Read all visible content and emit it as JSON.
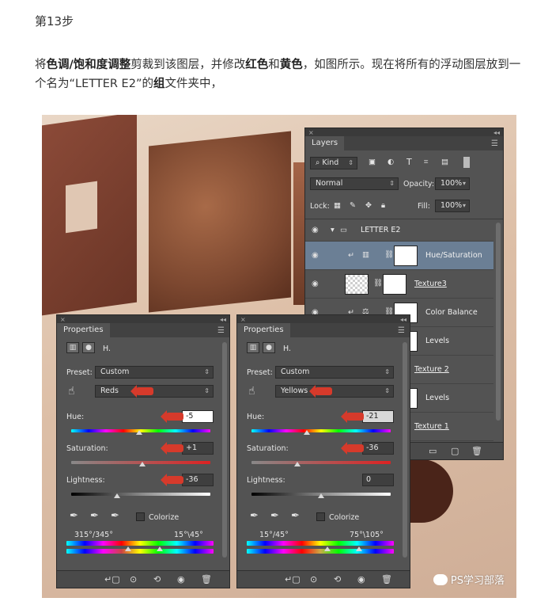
{
  "article": {
    "step_title": "第13步",
    "p1_a": "将",
    "p1_b": "色调/饱和度调整",
    "p1_c": "剪裁到该图层，并修改",
    "p1_d": "红色",
    "p1_e": "和",
    "p1_f": "黄色",
    "p1_g": "，如图所示。现在将所有的浮动图层放到一个名为“LETTER E2”的",
    "p1_h": "组",
    "p1_i": "文件夹中，"
  },
  "layers_panel": {
    "tab": "Layers",
    "kind": "Kind",
    "blend_mode": "Normal",
    "opacity_label": "Opacity:",
    "opacity_value": "100%",
    "lock_label": "Lock:",
    "fill_label": "Fill:",
    "fill_value": "100%",
    "group_name": "LETTER E2",
    "layers": [
      {
        "name": "Hue/Saturation"
      },
      {
        "name": "Texture3"
      },
      {
        "name": "Color Balance"
      },
      {
        "name": "Levels"
      },
      {
        "name": "Texture 2"
      },
      {
        "name": "Levels"
      },
      {
        "name": "Texture 1"
      }
    ]
  },
  "props_left": {
    "tab": "Properties",
    "header": "H.",
    "preset_label": "Preset:",
    "preset_value": "Custom",
    "channel_value": "Reds",
    "hue_label": "Hue:",
    "hue_value": "-5",
    "saturation_label": "Saturation:",
    "saturation_value": "+1",
    "lightness_label": "Lightness:",
    "lightness_value": "-36",
    "colorize_label": "Colorize",
    "range_left": "315°/345°",
    "range_right": "15°\\45°"
  },
  "props_right": {
    "tab": "Properties",
    "header": "H.",
    "preset_label": "Preset:",
    "preset_value": "Custom",
    "channel_value": "Yellows",
    "hue_label": "Hue:",
    "hue_value": "-21",
    "saturation_label": "Saturation:",
    "saturation_value": "-36",
    "lightness_label": "Lightness:",
    "lightness_value": "0",
    "colorize_label": "Colorize",
    "range_left": "15°/45°",
    "range_right": "75°\\105°"
  },
  "watermark": "PS学习部落"
}
